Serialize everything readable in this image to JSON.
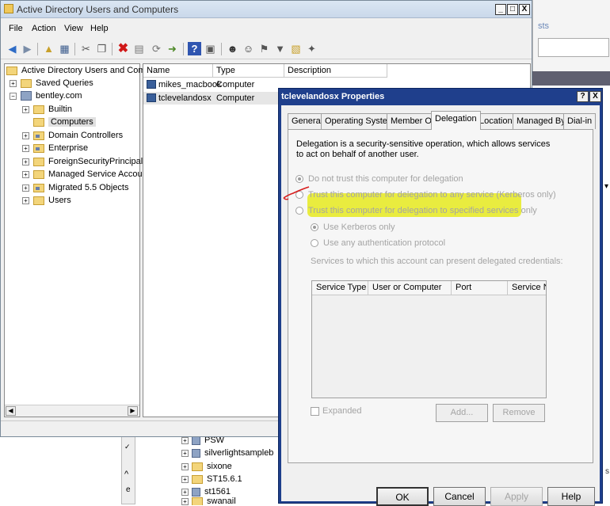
{
  "colors": {
    "highlighter": "#e6ea1e",
    "dialog_title_bar": "#1f3f8c",
    "annotation_pen": "#d81e1e"
  },
  "background": {
    "link_fragment": "sts",
    "tree_items": [
      {
        "label": "PSW"
      },
      {
        "label": "silverlightsampleb"
      },
      {
        "label": "sixone"
      },
      {
        "label": "ST15.6.1"
      },
      {
        "label": "st1561"
      },
      {
        "label": "swanail"
      }
    ],
    "scroll_chevron": "^",
    "letter_fragment": "e"
  },
  "window": {
    "title": "Active Directory Users and Computers",
    "minimize": "_",
    "maximize": "□",
    "close": "X"
  },
  "menu": {
    "file": "File",
    "action": "Action",
    "view": "View",
    "help": "Help"
  },
  "toolbar_icons": [
    "back-arrow-icon",
    "forward-arrow-icon",
    "up-folder-icon",
    "show-tree-icon",
    "cut-icon",
    "copy-icon",
    "delete-icon",
    "properties-icon",
    "refresh-icon",
    "export-list-icon",
    "help-icon",
    "mmc-icon",
    "user-icon",
    "users-icon",
    "group-icon",
    "filter-icon",
    "ou-icon",
    "add-to-group-icon"
  ],
  "tree": {
    "root": "Active Directory Users and Comput",
    "saved_queries": "Saved Queries",
    "domain": "bentley.com",
    "children": [
      {
        "label": "Builtin"
      },
      {
        "label": "Computers"
      },
      {
        "label": "Domain Controllers"
      },
      {
        "label": "Enterprise"
      },
      {
        "label": "ForeignSecurityPrincipals"
      },
      {
        "label": "Managed Service Accounts"
      },
      {
        "label": "Migrated 5.5 Objects"
      },
      {
        "label": "Users"
      }
    ]
  },
  "list": {
    "columns": {
      "name": "Name",
      "type": "Type",
      "description": "Description"
    },
    "rows": [
      {
        "name": "mikes_macbook",
        "type": "Computer"
      },
      {
        "name": "tclevelandosx",
        "type": "Computer"
      }
    ]
  },
  "dialog": {
    "title": "tclevelandosx Properties",
    "help_btn": "?",
    "close_btn": "X",
    "tabs": {
      "general": "General",
      "os": "Operating System",
      "member_of": "Member Of",
      "delegation": "Delegation",
      "location": "Location",
      "managed_by": "Managed By",
      "dial_in": "Dial-in"
    },
    "intro": "Delegation is a security-sensitive operation, which allows services to act on behalf of another user.",
    "options": {
      "no_trust": "Do not trust this computer for delegation",
      "trust_any": "Trust this computer for delegation to any service (Kerberos only)",
      "trust_specified": "Trust this computer for delegation to specified services only",
      "kerberos_only": "Use Kerberos only",
      "any_protocol": "Use any authentication protocol"
    },
    "services_label": "Services to which this account can present delegated credentials:",
    "grid_columns": {
      "service_type": "Service Type",
      "user_or_computer": "User or Computer",
      "port": "Port",
      "service_name": "Service N"
    },
    "expanded": "Expanded",
    "add": "Add...",
    "remove": "Remove",
    "buttons": {
      "ok": "OK",
      "cancel": "Cancel",
      "apply": "Apply",
      "help": "Help"
    }
  }
}
